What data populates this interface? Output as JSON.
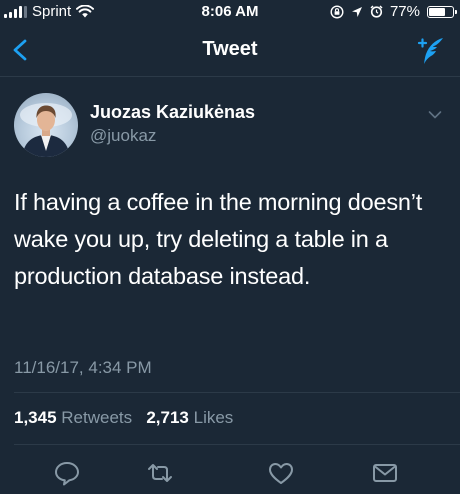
{
  "status_bar": {
    "carrier": "Sprint",
    "time": "8:06 AM",
    "battery_percent": "77%",
    "battery_level": 0.77,
    "icons": [
      "signal-bars-icon",
      "wifi-icon",
      "lock-rotation-icon",
      "location-arrow-icon",
      "alarm-icon",
      "battery-icon"
    ]
  },
  "nav": {
    "title": "Tweet",
    "back_icon": "chevron-left-icon",
    "compose_icon": "compose-tweet-icon"
  },
  "tweet": {
    "author_name": "Juozas Kaziukėnas",
    "author_handle": "@juokaz",
    "text": "If having a coffee in the morning doesn’t wake you up, try deleting a table in a production database instead.",
    "timestamp": "11/16/17, 4:34 PM",
    "retweets_count": "1,345",
    "retweets_label": "Retweets",
    "likes_count": "2,713",
    "likes_label": "Likes"
  },
  "actions": [
    {
      "name": "reply",
      "icon": "reply-icon"
    },
    {
      "name": "retweet",
      "icon": "retweet-icon"
    },
    {
      "name": "like",
      "icon": "heart-icon"
    },
    {
      "name": "share",
      "icon": "envelope-icon"
    }
  ],
  "colors": {
    "background": "#1b2836",
    "accent": "#1da1f2",
    "secondary_text": "#8899a6",
    "divider": "#2c3a48"
  }
}
